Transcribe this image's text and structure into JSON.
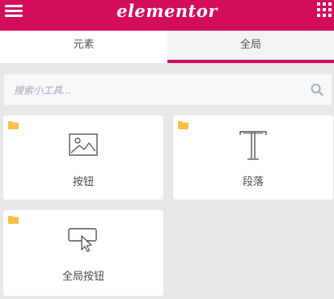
{
  "app": {
    "logo_text": "elementor"
  },
  "header": {
    "menu_icon": "hamburger-icon",
    "apps_icon": "grid-icon"
  },
  "tabs": [
    {
      "label": "元素",
      "active": false
    },
    {
      "label": "全局",
      "active": true
    }
  ],
  "search": {
    "placeholder": "搜索小工具..."
  },
  "widgets": [
    {
      "label": "按钮",
      "icon": "image-icon",
      "badge_icon": "folder-icon"
    },
    {
      "label": "段落",
      "icon": "text-icon",
      "badge_icon": "folder-icon"
    },
    {
      "label": "全局按钮",
      "icon": "button-cursor-icon",
      "badge_icon": "folder-icon"
    }
  ],
  "colors": {
    "brand": "#d30c5c",
    "folder": "#f6c142",
    "background": "#e6e8ea"
  }
}
